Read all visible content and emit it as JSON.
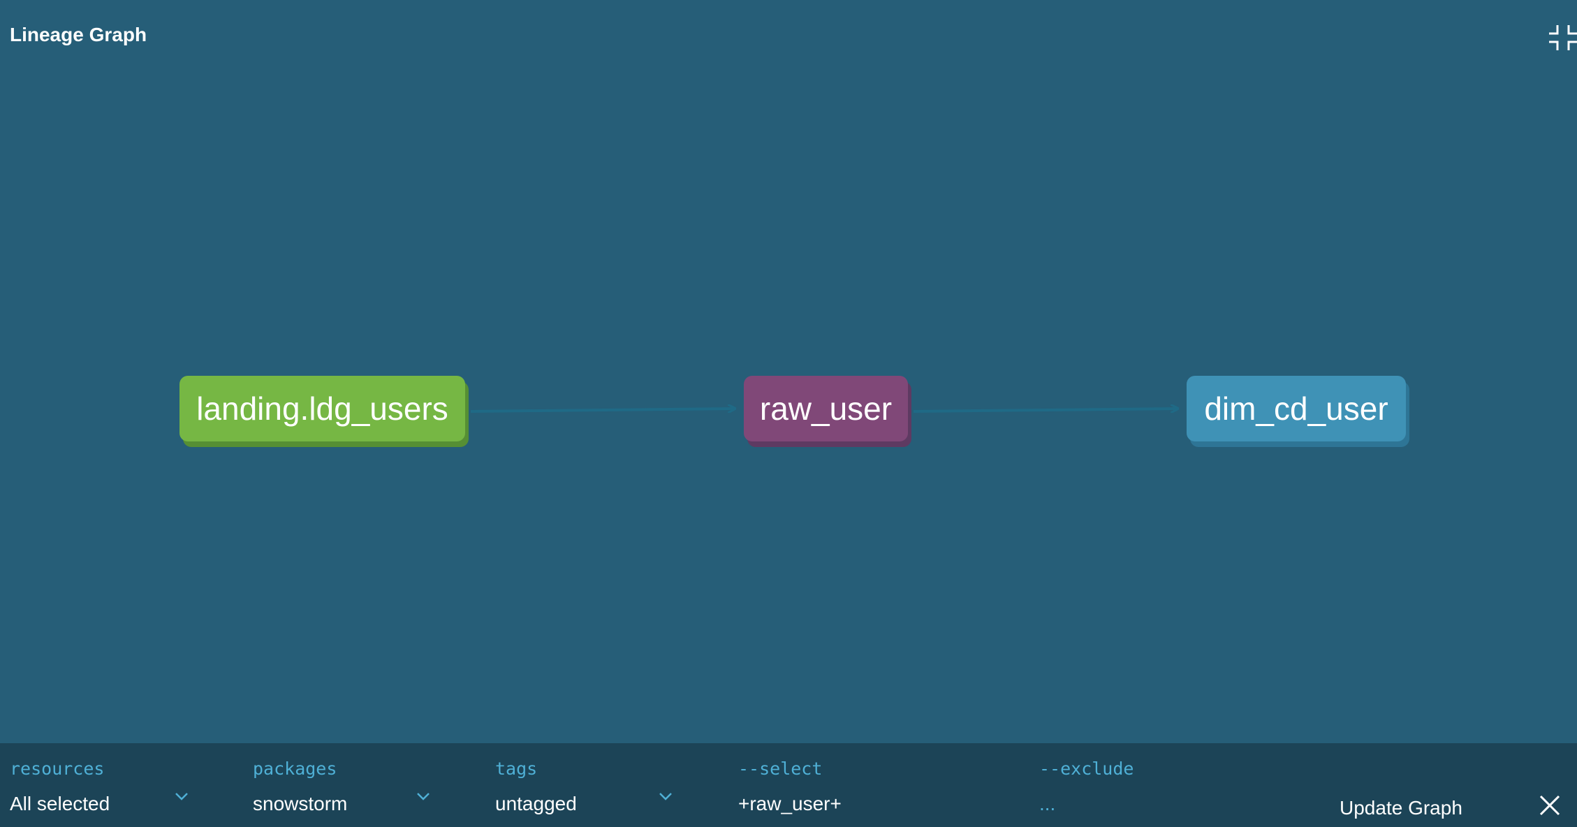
{
  "header": {
    "title": "Lineage Graph",
    "collapse_icon": "collapse-icon"
  },
  "graph": {
    "nodes": [
      {
        "label": "landing.ldg_users",
        "type": "source",
        "color": "#76b744"
      },
      {
        "label": "raw_user",
        "type": "model",
        "color": "#804878"
      },
      {
        "label": "dim_cd_user",
        "type": "model",
        "color": "#3f92b6"
      }
    ],
    "edges": [
      {
        "from": "landing.ldg_users",
        "to": "raw_user"
      },
      {
        "from": "raw_user",
        "to": "dim_cd_user"
      }
    ],
    "edge_color": "#1f6a86"
  },
  "toolbar": {
    "resources": {
      "label": "resources",
      "value": "All selected"
    },
    "packages": {
      "label": "packages",
      "value": "snowstorm"
    },
    "tags": {
      "label": "tags",
      "value": "untagged"
    },
    "select": {
      "label": "--select",
      "value": "+raw_user+"
    },
    "exclude": {
      "label": "--exclude",
      "value": "..."
    },
    "update_label": "Update Graph",
    "close_icon": "close-icon"
  },
  "colors": {
    "background": "#265e78",
    "toolbar_background": "#1c4457",
    "label_accent": "#4fb0d6"
  }
}
